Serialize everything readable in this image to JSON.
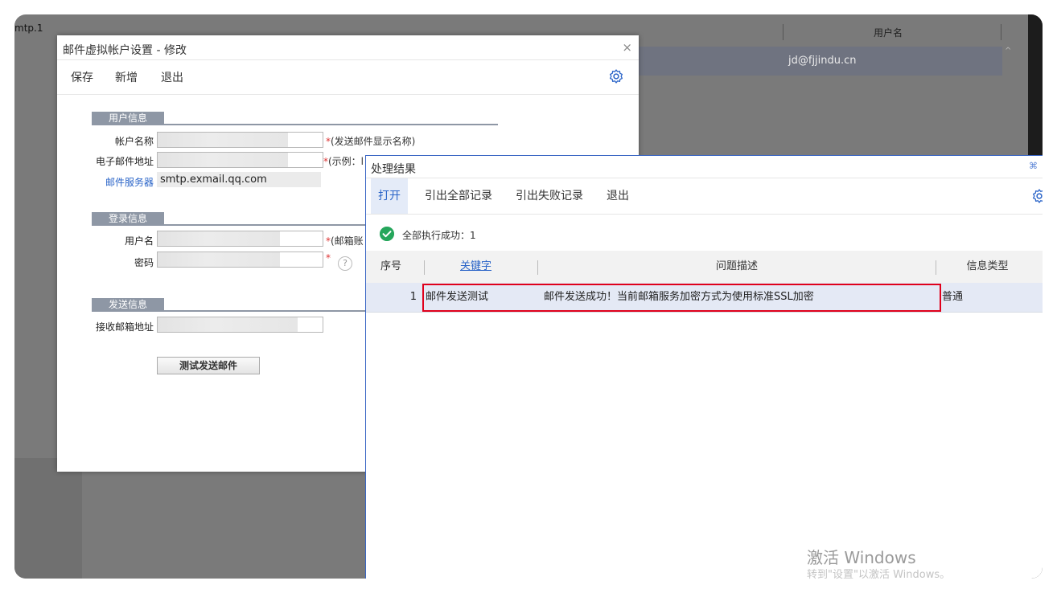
{
  "background": {
    "left_text": "mtp.1",
    "column_header": "用户名",
    "row_value": "jd@fjjindu.cn"
  },
  "dialog1": {
    "title": "邮件虚拟帐户设置 - 修改",
    "close_glyph": "×",
    "toolbar": {
      "save": "保存",
      "new": "新增",
      "exit": "退出"
    },
    "sections": {
      "user_info": "用户信息",
      "login_info": "登录信息",
      "send_info": "发送信息"
    },
    "fields": {
      "account_name_label": "帐户名称",
      "account_name_hint_star": "*",
      "account_name_hint": "(发送邮件显示名称)",
      "email_label": "电子邮件地址",
      "email_hint_star": "*",
      "email_hint": "(示例：l",
      "server_label": "邮件服务器",
      "server_value": "smtp.exmail.qq.com",
      "username_label": "用户名",
      "username_hint_star": "*",
      "username_hint": "(邮箱账",
      "password_label": "密码",
      "password_hint_star": "*",
      "recipient_label": "接收邮箱地址"
    },
    "help_glyph": "?",
    "test_button": "测试发送邮件"
  },
  "dialog2": {
    "title": "处理结果",
    "restore_glyph": "⌘",
    "toolbar": {
      "open": "打开",
      "export_all": "引出全部记录",
      "export_failed": "引出失败记录",
      "exit": "退出"
    },
    "status": "全部执行成功：1",
    "columns": {
      "seq": "序号",
      "keyword": "关键字",
      "description": "问题描述",
      "info_type": "信息类型"
    },
    "rows": [
      {
        "seq": "1",
        "keyword": "邮件发送测试",
        "description": "邮件发送成功！当前邮箱服务加密方式为使用标准SSL加密",
        "info_type": "普通"
      }
    ]
  },
  "watermark": {
    "line1": "激活 Windows",
    "line2": "转到\"设置\"以激活 Windows。"
  },
  "bottom_arrow": "»",
  "colors": {
    "accent": "#2a64c8",
    "success": "#25a65b",
    "highlight": "#e0001b"
  }
}
